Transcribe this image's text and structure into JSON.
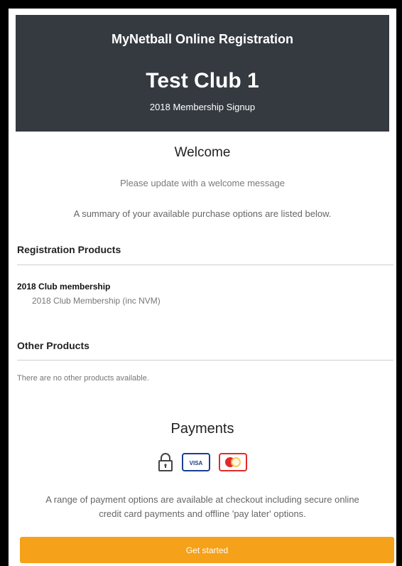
{
  "header": {
    "app_title": "MyNetball Online Registration",
    "club_name": "Test Club 1",
    "subtitle": "2018 Membership Signup"
  },
  "welcome": {
    "title": "Welcome",
    "message": "Please update with a welcome message",
    "summary": "A summary of your available purchase options are listed below."
  },
  "registration_products": {
    "title": "Registration Products",
    "items": [
      {
        "name": "2018 Club membership",
        "description": "2018 Club Membership (inc NVM)"
      }
    ]
  },
  "other_products": {
    "title": "Other Products",
    "empty_text": "There are no other products available."
  },
  "payments": {
    "title": "Payments",
    "icons": [
      "lock-icon",
      "visa-card-icon",
      "mastercard-icon"
    ],
    "visa_text": "VISA",
    "description": "A range of payment options are available at checkout including secure online credit card payments and offline 'pay later' options."
  },
  "actions": {
    "get_started_label": "Get started"
  },
  "colors": {
    "header_bg": "#343a40",
    "cta_bg": "#f5a11a",
    "visa_blue": "#1a3f8f",
    "mastercard_red": "#e02b2b"
  }
}
